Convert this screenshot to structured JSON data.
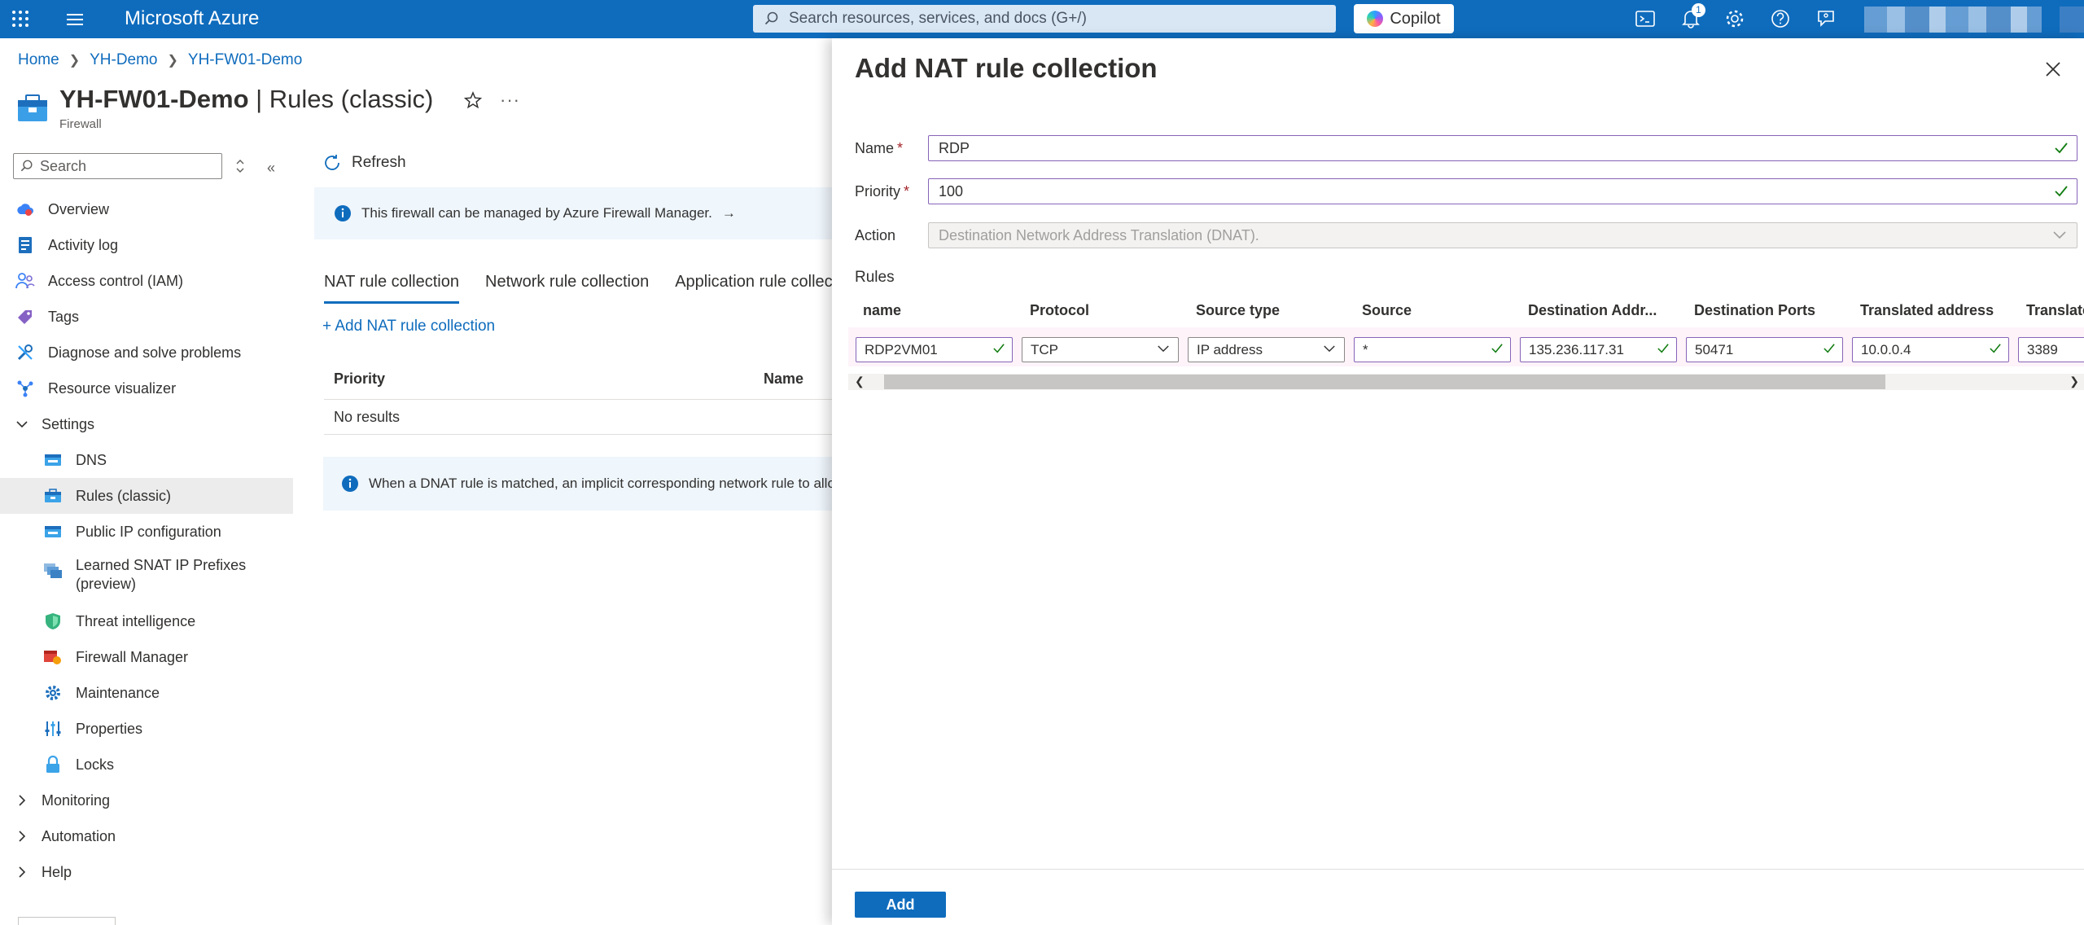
{
  "topbar": {
    "brand": "Microsoft Azure",
    "search_placeholder": "Search resources, services, and docs (G+/)",
    "copilot_label": "Copilot",
    "notification_count": "1"
  },
  "breadcrumb": [
    "Home",
    "YH-Demo",
    "YH-FW01-Demo"
  ],
  "page": {
    "title_bold": "YH-FW01-Demo",
    "title_rest": " | Rules (classic)",
    "subtitle": "Firewall"
  },
  "sidebar": {
    "search_placeholder": "Search",
    "items": [
      {
        "label": "Overview"
      },
      {
        "label": "Activity log"
      },
      {
        "label": "Access control (IAM)"
      },
      {
        "label": "Tags"
      },
      {
        "label": "Diagnose and solve problems"
      },
      {
        "label": "Resource visualizer"
      },
      {
        "label": "Settings"
      },
      {
        "label": "DNS"
      },
      {
        "label": "Rules (classic)"
      },
      {
        "label": "Public IP configuration"
      },
      {
        "label": "Learned SNAT IP Prefixes (preview)"
      },
      {
        "label": "Threat intelligence"
      },
      {
        "label": "Firewall Manager"
      },
      {
        "label": "Maintenance"
      },
      {
        "label": "Properties"
      },
      {
        "label": "Locks"
      },
      {
        "label": "Monitoring"
      },
      {
        "label": "Automation"
      },
      {
        "label": "Help"
      }
    ]
  },
  "main": {
    "refresh_label": "Refresh",
    "info_banner": "This firewall can be managed by Azure Firewall Manager.",
    "tabs": [
      "NAT rule collection",
      "Network rule collection",
      "Application rule collection"
    ],
    "add_link": "+ Add NAT rule collection",
    "table_headers": [
      "Priority",
      "Name"
    ],
    "no_results": "No results",
    "dnat_banner": "When a DNAT rule is matched, an implicit corresponding network rule to allow the translated traffic is added."
  },
  "panel": {
    "title": "Add NAT rule collection",
    "name_label": "Name",
    "name_value": "RDP",
    "priority_label": "Priority",
    "priority_value": "100",
    "action_label": "Action",
    "action_value": "Destination Network Address Translation (DNAT).",
    "rules_label": "Rules",
    "columns": [
      "name",
      "Protocol",
      "Source type",
      "Source",
      "Destination Addr...",
      "Destination Ports",
      "Translated address",
      "Translated port"
    ],
    "row": [
      "RDP2VM01",
      "TCP",
      "IP address",
      "*",
      "135.236.117.31",
      "50471",
      "10.0.0.4",
      "3389"
    ],
    "add_button": "Add"
  }
}
